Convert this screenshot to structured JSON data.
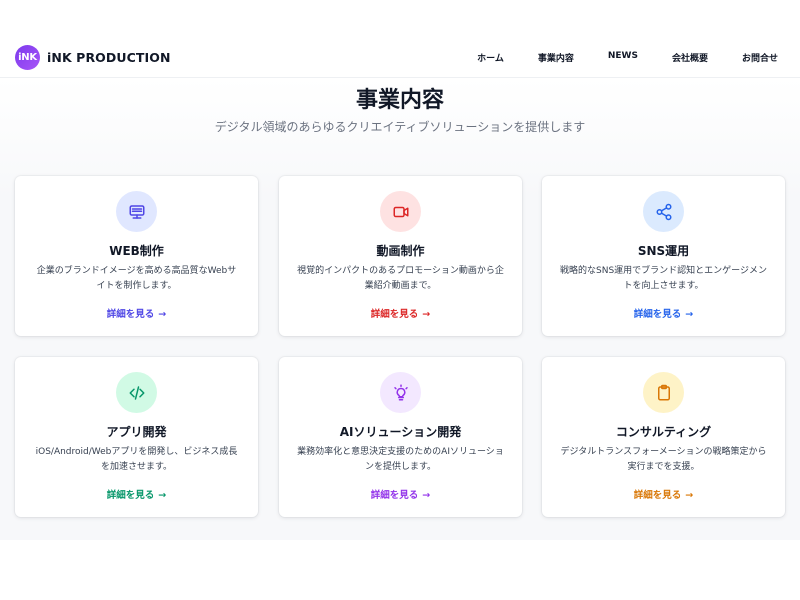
{
  "header": {
    "logo_text": "iNK",
    "brand_name": "iNK PRODUCTION",
    "nav": [
      "ホーム",
      "事業内容",
      "NEWS",
      "会社概要",
      "お問合せ"
    ]
  },
  "section": {
    "title": "事業内容",
    "subtitle": "デジタル領域のあらゆるクリエイティブソリューションを提供します"
  },
  "cards": [
    {
      "icon": "monitor-icon",
      "title": "WEB制作",
      "desc": "企業のブランドイメージを高める高品質なWebサイトを制作します。",
      "link": "詳細を見る",
      "accent": "#4f46e5",
      "icon_bg": "#e0e7ff"
    },
    {
      "icon": "video-icon",
      "title": "動画制作",
      "desc": "視覚的インパクトのあるプロモーション動画から企業紹介動画まで。",
      "link": "詳細を見る",
      "accent": "#dc2626",
      "icon_bg": "#fee2e2"
    },
    {
      "icon": "share-icon",
      "title": "SNS運用",
      "desc": "戦略的なSNS運用でブランド認知とエンゲージメントを向上させます。",
      "link": "詳細を見る",
      "accent": "#2563eb",
      "icon_bg": "#dbeafe"
    },
    {
      "icon": "code-icon",
      "title": "アプリ開発",
      "desc": "iOS/Android/Webアプリを開発し、ビジネス成長を加速させます。",
      "link": "詳細を見る",
      "accent": "#059669",
      "icon_bg": "#d1fae5"
    },
    {
      "icon": "lightbulb-icon",
      "title": "AIソリューション開発",
      "desc": "業務効率化と意思決定支援のためのAIソリューションを提供します。",
      "link": "詳細を見る",
      "accent": "#9333ea",
      "icon_bg": "#f3e8ff"
    },
    {
      "icon": "clipboard-icon",
      "title": "コンサルティング",
      "desc": "デジタルトランスフォーメーションの戦略策定から実行までを支援。",
      "link": "詳細を見る",
      "accent": "#d97706",
      "icon_bg": "#fef3c7"
    }
  ],
  "link_arrow": "→"
}
